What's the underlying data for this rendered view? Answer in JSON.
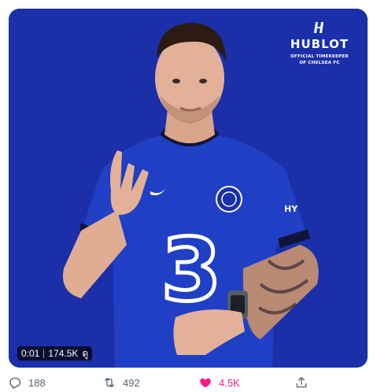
{
  "media": {
    "brand": {
      "name": "HUBLOT",
      "tagline_line1": "OFFICIAL TIMEKEEPER",
      "tagline_line2": "OF CHELSEA FC"
    },
    "shirt_sponsor": "3",
    "sleeve_text": "HY",
    "background_color": "#1a2fa8",
    "video": {
      "time": "0:01",
      "views": "174.5K",
      "views_suffix": "ดู"
    }
  },
  "actions": {
    "reply_count": "188",
    "retweet_count": "492",
    "like_count": "4.5K",
    "like_active": true,
    "like_color": "#f91880",
    "icons": [
      "reply-icon",
      "retweet-icon",
      "heart-icon",
      "share-icon"
    ]
  }
}
